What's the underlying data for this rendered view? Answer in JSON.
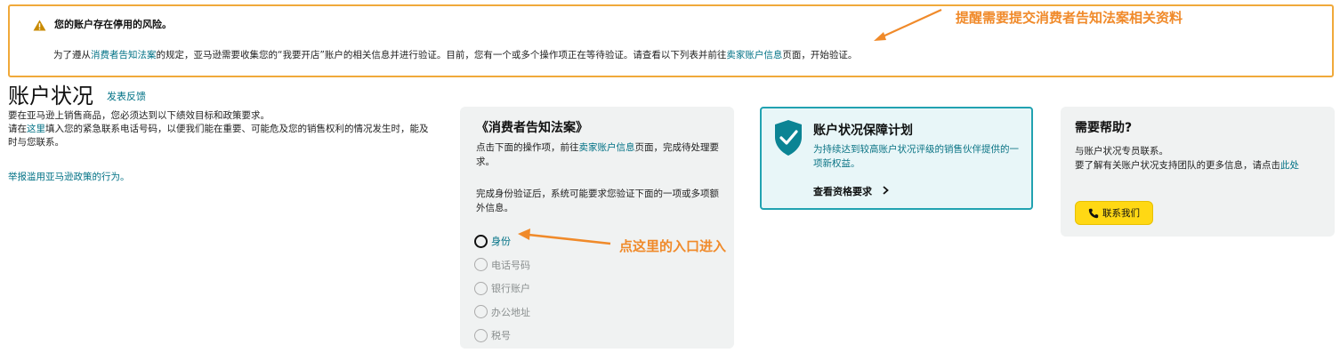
{
  "banner": {
    "title": "您的账户存在停用的风险。",
    "text_prefix": "为了遵从",
    "text_link1": "消费者告知法案",
    "text_middle": "的规定，亚马逊需要收集您的“我要开店”账户的相关信息并进行验证。目前，您有一个或多个操作项正在等待验证。请查看以下列表并前往",
    "text_link2": "卖家账户信息",
    "text_suffix": "页面，开始验证。"
  },
  "annotations": {
    "top": "提醒需要提交消费者告知法案相关资料",
    "middle": "点这里的入口进入"
  },
  "page": {
    "title": "账户状况",
    "feedback": "发表反馈",
    "line1": "要在亚马逊上销售商品，您必须达到以下绩效目标和政策要求。",
    "line2_prefix": "请在",
    "line2_link": "这里",
    "line2_suffix": "填入您的紧急联系电话号码，以便我们能在重要、可能危及您的销售权利的情况发生时，能及时与您联系。",
    "report_link": "举报滥用亚马逊政策的行为。"
  },
  "consumer_card": {
    "title": "《消费者告知法案》",
    "desc_prefix": "点击下面的操作项，前往",
    "desc_link": "卖家账户信息",
    "desc_suffix": "页面，完成待处理要求。",
    "desc2": "完成身份验证后，系统可能要求您验证下面的一项或多项额外信息。",
    "items": [
      {
        "label": "身份",
        "active": true
      },
      {
        "label": "电话号码",
        "active": false
      },
      {
        "label": "银行账户",
        "active": false
      },
      {
        "label": "办公地址",
        "active": false
      },
      {
        "label": "税号",
        "active": false
      }
    ]
  },
  "assurance_card": {
    "title": "账户状况保障计划",
    "desc": "为持续达到较高账户状况评级的销售伙伴提供的一项新权益。",
    "link": "查看资格要求"
  },
  "help_card": {
    "title": "需要帮助?",
    "line1": "与账户状况专员联系。",
    "line2": "要了解有关账户状况支持团队的更多信息，请点击",
    "line2_link": "此处",
    "button": "联系我们"
  },
  "colors": {
    "warning_border": "#f0a93a",
    "link": "#007185",
    "annotation": "#f08a2a",
    "assurance_border": "#21a2b1",
    "button": "#ffd814"
  }
}
